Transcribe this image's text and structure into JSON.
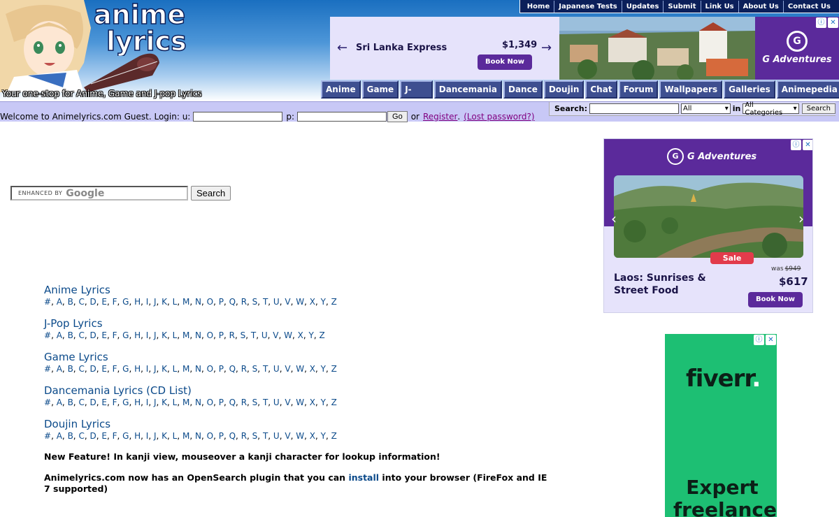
{
  "header": {
    "logo_line1": "anime",
    "logo_line2": "lyrics",
    "tagline": "Your one-stop for Anime, Game and J-pop Lyrics"
  },
  "top_nav": [
    "Home",
    "Japanese Tests",
    "Updates",
    "Submit",
    "Link Us",
    "About Us",
    "Contact Us"
  ],
  "top_ad": {
    "title": "Sri Lanka Express",
    "price": "$1,349",
    "button": "Book Now",
    "brand": "G Adventures",
    "brand_mark": "G",
    "back_icon": "arrow-left-icon",
    "forward_icon": "arrow-right-icon"
  },
  "main_nav": [
    "Anime",
    "Game",
    "J-Pop / J-Rock",
    "Dancemania",
    "Dance CD List",
    "Doujin",
    "Chat",
    "Forum",
    "Wallpapers",
    "Galleries",
    "Animepedia"
  ],
  "login": {
    "welcome": "Welcome to Animelyrics.com Guest. Login: u:",
    "password_label": "p:",
    "go": "Go",
    "or": "or",
    "register": "Register",
    "dot": ".",
    "lost_password": "(Lost password?)"
  },
  "site_search": {
    "label": "Search:",
    "scope": "All",
    "in": "in",
    "category": "All Categories",
    "button": "Search"
  },
  "google_search": {
    "enhanced_by": "ENHANCED BY",
    "brand": "Google",
    "button": "Search"
  },
  "sections": [
    {
      "title": "Anime Lyrics",
      "letters": [
        "#",
        "A",
        "B",
        "C",
        "D",
        "E",
        "F",
        "G",
        "H",
        "I",
        "J",
        "K",
        "L",
        "M",
        "N",
        "O",
        "P",
        "Q",
        "R",
        "S",
        "T",
        "U",
        "V",
        "W",
        "X",
        "Y",
        "Z"
      ]
    },
    {
      "title": "J-Pop Lyrics",
      "letters": [
        "#",
        "A",
        "B",
        "C",
        "D",
        "E",
        "F",
        "G",
        "H",
        "I",
        "J",
        "K",
        "L",
        "M",
        "N",
        "O",
        "P",
        "R",
        "S",
        "T",
        "U",
        "V",
        "W",
        "X",
        "Y",
        "Z"
      ]
    },
    {
      "title": "Game Lyrics",
      "letters": [
        "#",
        "A",
        "B",
        "C",
        "D",
        "E",
        "F",
        "G",
        "H",
        "I",
        "J",
        "K",
        "L",
        "M",
        "N",
        "O",
        "P",
        "Q",
        "R",
        "S",
        "T",
        "U",
        "V",
        "W",
        "X",
        "Y",
        "Z"
      ]
    },
    {
      "title": "Dancemania Lyrics (CD List)",
      "letters": [
        "#",
        "A",
        "B",
        "C",
        "D",
        "E",
        "F",
        "G",
        "H",
        "I",
        "J",
        "K",
        "L",
        "M",
        "N",
        "O",
        "P",
        "Q",
        "R",
        "S",
        "T",
        "U",
        "V",
        "W",
        "X",
        "Y",
        "Z"
      ]
    },
    {
      "title": "Doujin Lyrics",
      "letters": [
        "#",
        "A",
        "B",
        "C",
        "D",
        "E",
        "F",
        "G",
        "H",
        "I",
        "J",
        "K",
        "L",
        "M",
        "N",
        "O",
        "P",
        "Q",
        "R",
        "S",
        "T",
        "U",
        "V",
        "W",
        "X",
        "Y",
        "Z"
      ]
    }
  ],
  "notes": {
    "kanji": "New Feature! In kanji view, mouseover a kanji character for lookup information!",
    "opensearch_before": "Animelyrics.com now has an OpenSearch plugin that you can",
    "opensearch_link": "install",
    "opensearch_after": "into your browser (FireFox and IE 7 supported)"
  },
  "right_ad": {
    "brand": "G Adventures",
    "brand_mark": "G",
    "sale": "Sale",
    "title": "Laos: Sunrises & Street Food",
    "was_label": "was",
    "was_price": "$949",
    "price": "$617",
    "button": "Book Now"
  },
  "fiverr_ad": {
    "logo": "fiverr",
    "logo_dot": ".",
    "headline": "Expert freelance"
  },
  "colors": {
    "nav_tab": "#3e4f90",
    "strip": "#c8c8f6",
    "link": "#0b4a8a",
    "ad_purple": "#5b2a9b",
    "fiverr_green": "#1dbf73"
  }
}
